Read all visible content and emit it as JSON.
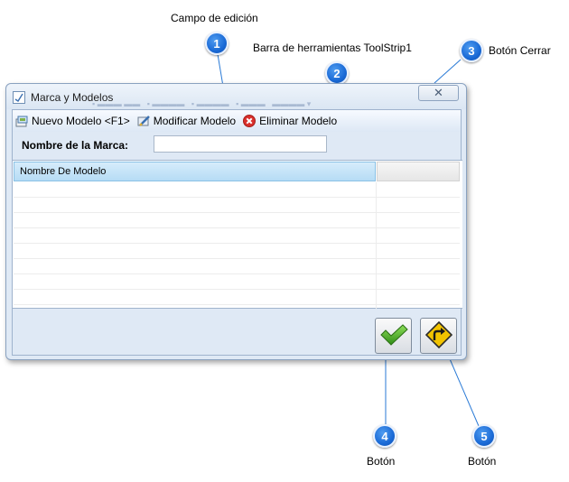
{
  "annotations": {
    "editing_field": "Campo de edición",
    "toolstrip": "Barra de herramientas ToolStrip1",
    "close_button": "Botón Cerrar",
    "button_4": "Botón",
    "button_5": "Botón"
  },
  "badges": [
    "1",
    "2",
    "3",
    "4",
    "5"
  ],
  "window": {
    "title": "Marca y Modelos",
    "close_glyph": "✕"
  },
  "toolbar": {
    "new_label": "Nuevo Modelo <F1>",
    "edit_label": "Modificar Modelo",
    "delete_label": "Eliminar Modelo"
  },
  "form": {
    "brand_label": "Nombre de la Marca:",
    "brand_value": "",
    "brand_placeholder": ""
  },
  "grid": {
    "columns": [
      "Nombre De Modelo"
    ],
    "rows": []
  },
  "icons": {
    "new": "new-model-icon",
    "edit": "edit-model-icon",
    "delete": "delete-model-icon",
    "accept": "checkmark-icon",
    "exit": "exit-sign-icon"
  },
  "colors": {
    "badge": "#1a6ad6",
    "accept": "#4cae2a",
    "exit": "#f2c300",
    "delete": "#d9302c",
    "callout_line": "#2a7ad6"
  }
}
